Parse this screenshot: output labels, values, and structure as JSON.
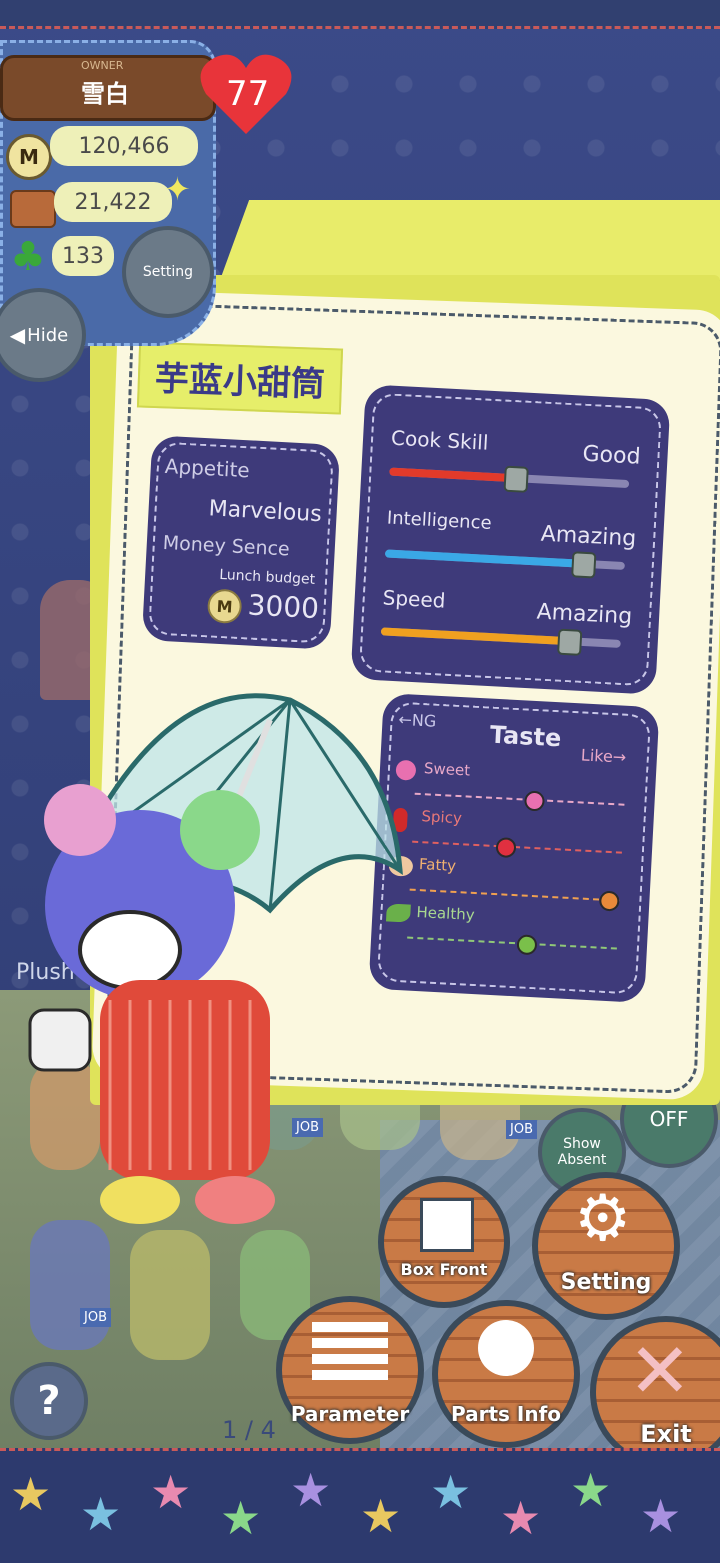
{
  "hud": {
    "owner_label": "OWNER",
    "owner_name": "雪白",
    "heart_count": "77",
    "coins": "120,466",
    "food": "21,422",
    "clover": "133",
    "setting_small_label": "Setting",
    "hide_label": "Hide",
    "coin_glyph": "M"
  },
  "card": {
    "dish_name": "芋蓝小甜筒",
    "appetite_label": "Appetite",
    "appetite_value": "Marvelous",
    "money_label": "Money Sence",
    "lunch_label": "Lunch budget",
    "lunch_value": "3000",
    "stats": [
      {
        "label": "Cook Skill",
        "value": "Good",
        "level": 0.52,
        "color": "#e23a2a"
      },
      {
        "label": "Intelligence",
        "value": "Amazing",
        "level": 0.82,
        "color": "#3aa8e6"
      },
      {
        "label": "Speed",
        "value": "Amazing",
        "level": 0.78,
        "color": "#f0a020"
      }
    ],
    "taste": {
      "title": "Taste",
      "ng_label": "←NG",
      "like_label": "Like→",
      "rows": [
        {
          "label": "Sweet",
          "level": 0.55,
          "color": "#e870b0"
        },
        {
          "label": "Spicy",
          "level": 0.42,
          "color": "#e03040"
        },
        {
          "label": "Fatty",
          "level": 0.95,
          "color": "#e88a3a"
        },
        {
          "label": "Healthy",
          "level": 0.55,
          "color": "#7ac04a"
        }
      ]
    }
  },
  "room": {
    "plush_label": "Plush",
    "page": "1 / 4",
    "show_absent": "Show Absent",
    "off_label": "OFF",
    "job_label": "JOB"
  },
  "buttons": {
    "box_front": "Box Front",
    "setting": "Setting",
    "parameter": "Parameter",
    "parts_info": "Parts Info",
    "exit": "Exit",
    "help": "?"
  }
}
